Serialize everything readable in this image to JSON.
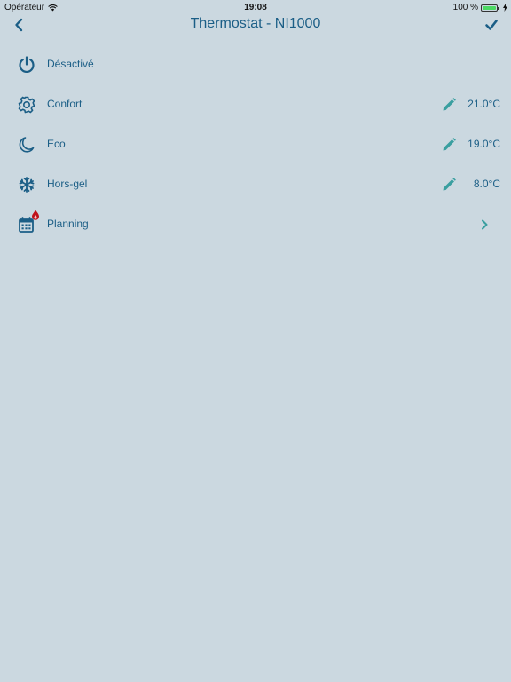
{
  "status_bar": {
    "carrier": "Opérateur",
    "time": "19:08",
    "battery_text": "100 %"
  },
  "nav": {
    "title": "Thermostat - NI1000"
  },
  "modes": [
    {
      "label": "Désactivé",
      "icon": "power-icon"
    },
    {
      "label": "Confort",
      "icon": "gear-icon",
      "value": "21.0°C"
    },
    {
      "label": "Eco",
      "icon": "moon-icon",
      "value": "19.0°C"
    },
    {
      "label": "Hors-gel",
      "icon": "snowflake-icon",
      "value": "8.0°C"
    },
    {
      "label": "Planning",
      "icon": "calendar-icon"
    }
  ],
  "colors": {
    "background": "#cbd8e0",
    "primary_text": "#1b5e86",
    "edit_icon": "#3a9fa0",
    "badge": "#c0121b",
    "battery": "#4cd964"
  }
}
